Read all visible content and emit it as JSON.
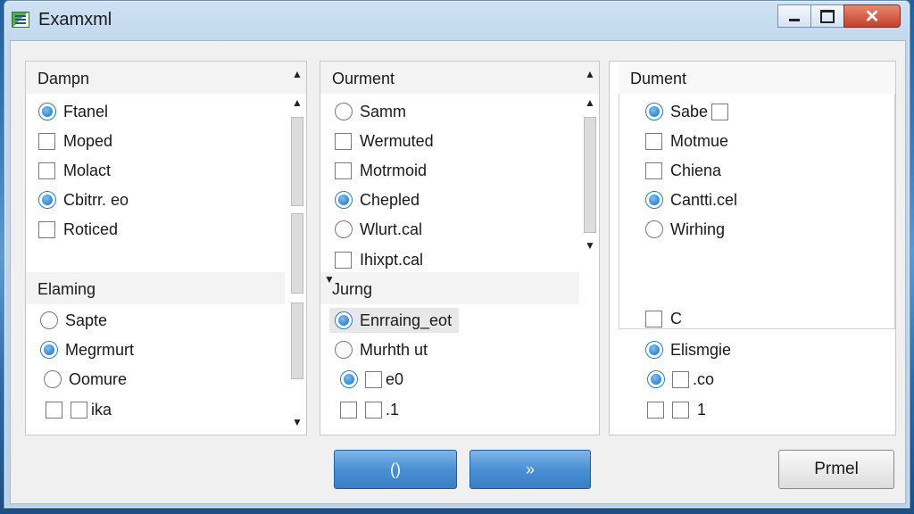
{
  "window": {
    "title": "Examxml"
  },
  "panels": [
    {
      "sections": [
        {
          "header": "Dampn",
          "items": [
            {
              "type": "radio",
              "checked": true,
              "label": "Ftanel"
            },
            {
              "type": "check",
              "checked": false,
              "label": "Moped"
            },
            {
              "type": "check",
              "checked": false,
              "label": "Molact"
            },
            {
              "type": "radio",
              "checked": true,
              "label": "Cbitrr. eo"
            },
            {
              "type": "check",
              "checked": false,
              "label": "Roticed"
            }
          ]
        },
        {
          "header": "Elaming",
          "items": [
            {
              "type": "radio",
              "checked": false,
              "label": "Sapte"
            },
            {
              "type": "radio",
              "checked": true,
              "label": "Megrmurt"
            },
            {
              "type": "radio",
              "checked": false,
              "label": "Oomure"
            },
            {
              "type": "check",
              "checked": false,
              "label": "ika"
            }
          ]
        }
      ]
    },
    {
      "sections": [
        {
          "header": "Ourment",
          "items": [
            {
              "type": "radio",
              "checked": false,
              "label": "Samm"
            },
            {
              "type": "check",
              "checked": false,
              "label": "Wermuted"
            },
            {
              "type": "check",
              "checked": false,
              "label": "Motrmoid"
            },
            {
              "type": "radio",
              "checked": true,
              "label": "Chepled"
            },
            {
              "type": "radio",
              "checked": false,
              "label": "Wlurt.cal"
            },
            {
              "type": "check",
              "checked": false,
              "label": "Ihixpt.cal"
            }
          ]
        },
        {
          "header": "Jurng",
          "items": [
            {
              "type": "radio",
              "checked": true,
              "label": "Enrraing_eot"
            },
            {
              "type": "radio",
              "checked": false,
              "label": "Murhth ut"
            },
            {
              "type": "radio",
              "checked": true,
              "label": "e0"
            },
            {
              "type": "check",
              "checked": false,
              "label": ".1"
            }
          ]
        }
      ]
    },
    {
      "sections": [
        {
          "header": "Dument",
          "items": [
            {
              "type": "radio",
              "checked": true,
              "label": "Sabe"
            },
            {
              "type": "check",
              "checked": false,
              "label": "Motmue"
            },
            {
              "type": "check",
              "checked": false,
              "label": "Chiena"
            },
            {
              "type": "radio",
              "checked": true,
              "label": "Cantti.cel"
            },
            {
              "type": "radio",
              "checked": false,
              "label": "Wirhing"
            }
          ]
        },
        {
          "items": [
            {
              "type": "check",
              "checked": false,
              "label": "C"
            },
            {
              "type": "radio",
              "checked": true,
              "label": "Elismgie"
            },
            {
              "type": "radio",
              "checked": true,
              "label": ".co"
            },
            {
              "type": "check",
              "checked": false,
              "label": "1"
            }
          ]
        }
      ]
    }
  ],
  "buttons": {
    "back": "()",
    "next": "»",
    "cancel": "Prmel"
  },
  "icons": {
    "app": "app-table-icon",
    "minimize": "minimize-icon",
    "maximize": "maximize-icon",
    "close": "close-icon"
  }
}
